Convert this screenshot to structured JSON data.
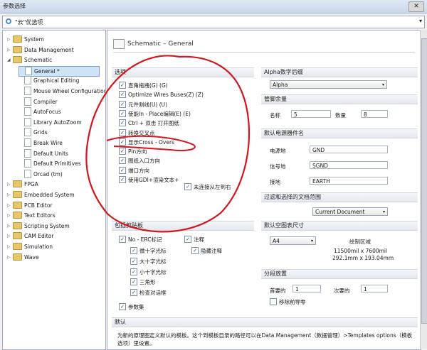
{
  "window": {
    "title": "参数选择",
    "close_label": "✕"
  },
  "address": {
    "value": "\"云\"优选项"
  },
  "tree": {
    "items": [
      {
        "label": "System",
        "expander": "▷",
        "icon": "folder"
      },
      {
        "label": "Data Management",
        "expander": "▷",
        "icon": "folder"
      },
      {
        "label": "Schematic",
        "expander": "◢",
        "icon": "folder"
      },
      {
        "label": "General *",
        "expander": "",
        "icon": "page",
        "selected": true
      },
      {
        "label": "Graphical Editing",
        "expander": "",
        "icon": "page"
      },
      {
        "label": "Mouse Wheel Configuration",
        "expander": "",
        "icon": "page"
      },
      {
        "label": "Compiler",
        "expander": "",
        "icon": "page"
      },
      {
        "label": "AutoFocus",
        "expander": "",
        "icon": "page"
      },
      {
        "label": "Library AutoZoom",
        "expander": "",
        "icon": "page"
      },
      {
        "label": "Grids",
        "expander": "",
        "icon": "page"
      },
      {
        "label": "Break Wire",
        "expander": "",
        "icon": "page"
      },
      {
        "label": "Default Units",
        "expander": "",
        "icon": "page"
      },
      {
        "label": "Default Primitives",
        "expander": "",
        "icon": "page"
      },
      {
        "label": "Orcad (tm)",
        "expander": "",
        "icon": "page"
      },
      {
        "label": "FPGA",
        "expander": "▷",
        "icon": "folder"
      },
      {
        "label": "Embedded System",
        "expander": "▷",
        "icon": "folder"
      },
      {
        "label": "PCB Editor",
        "expander": "▷",
        "icon": "folder"
      },
      {
        "label": "Text Editors",
        "expander": "▷",
        "icon": "folder"
      },
      {
        "label": "Scripting System",
        "expander": "▷",
        "icon": "folder"
      },
      {
        "label": "CAM Editor",
        "expander": "▷",
        "icon": "folder"
      },
      {
        "label": "Simulation",
        "expander": "▷",
        "icon": "folder"
      },
      {
        "label": "Wave",
        "expander": "▷",
        "icon": "folder"
      }
    ]
  },
  "page": {
    "header": "Schematic – General"
  },
  "options": {
    "title": "选项",
    "items": [
      {
        "label": "直角拖拽(G) (G)",
        "checked": true
      },
      {
        "label": "Optimize Wires Buses(Z) (Z)",
        "checked": true
      },
      {
        "label": "元件割线(U) (U)",
        "checked": true
      },
      {
        "label": "使能In - Place编辑(E) (E)",
        "checked": true
      },
      {
        "label": "Ctrl + 双击 打开图纸",
        "checked": true
      },
      {
        "label": "转换交叉点",
        "checked": true
      },
      {
        "label": "显示Cross - Overs",
        "checked": true
      },
      {
        "label": "Pin方向",
        "checked": true
      },
      {
        "label": "图纸入口方向",
        "checked": true
      },
      {
        "label": "端口方向",
        "checked": true
      },
      {
        "label": "使用GDI+渲染文本+",
        "checked": true
      }
    ],
    "unconnected": {
      "label": "未连接从左到右",
      "checked": true
    }
  },
  "alpha": {
    "title": "Alpha数字后缀",
    "value": "Alpha"
  },
  "pin_margin": {
    "title": "管脚余量",
    "name_label": "名称",
    "name_value": "5",
    "number_label": "数量",
    "number_value": "8"
  },
  "power": {
    "title": "默认电源器件名",
    "rows": [
      {
        "label": "电源地",
        "value": "GND"
      },
      {
        "label": "信号地",
        "value": "SGND"
      },
      {
        "label": "接地",
        "value": "EARTH"
      }
    ]
  },
  "filter": {
    "title": "过滤和选择的文档范围",
    "value": "Current Document"
  },
  "clipboard": {
    "title": "包括剪贴板",
    "no_erc": {
      "label": "No - ERC标记",
      "checked": true
    },
    "notes": {
      "label": "注释",
      "checked": true
    },
    "sub": [
      {
        "label": "微十字光标",
        "checked": true
      },
      {
        "label": "大十字光标",
        "checked": true
      },
      {
        "label": "小十字光标",
        "checked": true
      },
      {
        "label": "三角形",
        "checked": true
      },
      {
        "label": "检查对话框",
        "checked": true
      }
    ],
    "hidden_notes": {
      "label": "隐藏注释",
      "checked": true
    },
    "params": {
      "label": "参数集",
      "checked": true
    }
  },
  "sheet_size": {
    "title": "默认空图表尺寸",
    "value": "A4",
    "area_label": "绘制区域",
    "dim1": "11500mil x 7600mil",
    "dim2": "292.1mm x 193.04mm"
  },
  "segment": {
    "title": "分段放置",
    "primary_label": "首要的",
    "primary_value": "1",
    "secondary_label": "次要的",
    "secondary_value": "1",
    "remove_zero": {
      "label": "移除前导零",
      "checked": false
    }
  },
  "defaults": {
    "title": "默认",
    "text": "为新的原理图定义默认的模板。这个到模板目录的路径可以在Data Management（数据管理）>Templates options（模板选项）里设置。"
  },
  "colors": {
    "annotation": "#d4161c",
    "selection": "#cde4f7"
  },
  "icons": {
    "check": "✓",
    "dropdown": "▾"
  }
}
